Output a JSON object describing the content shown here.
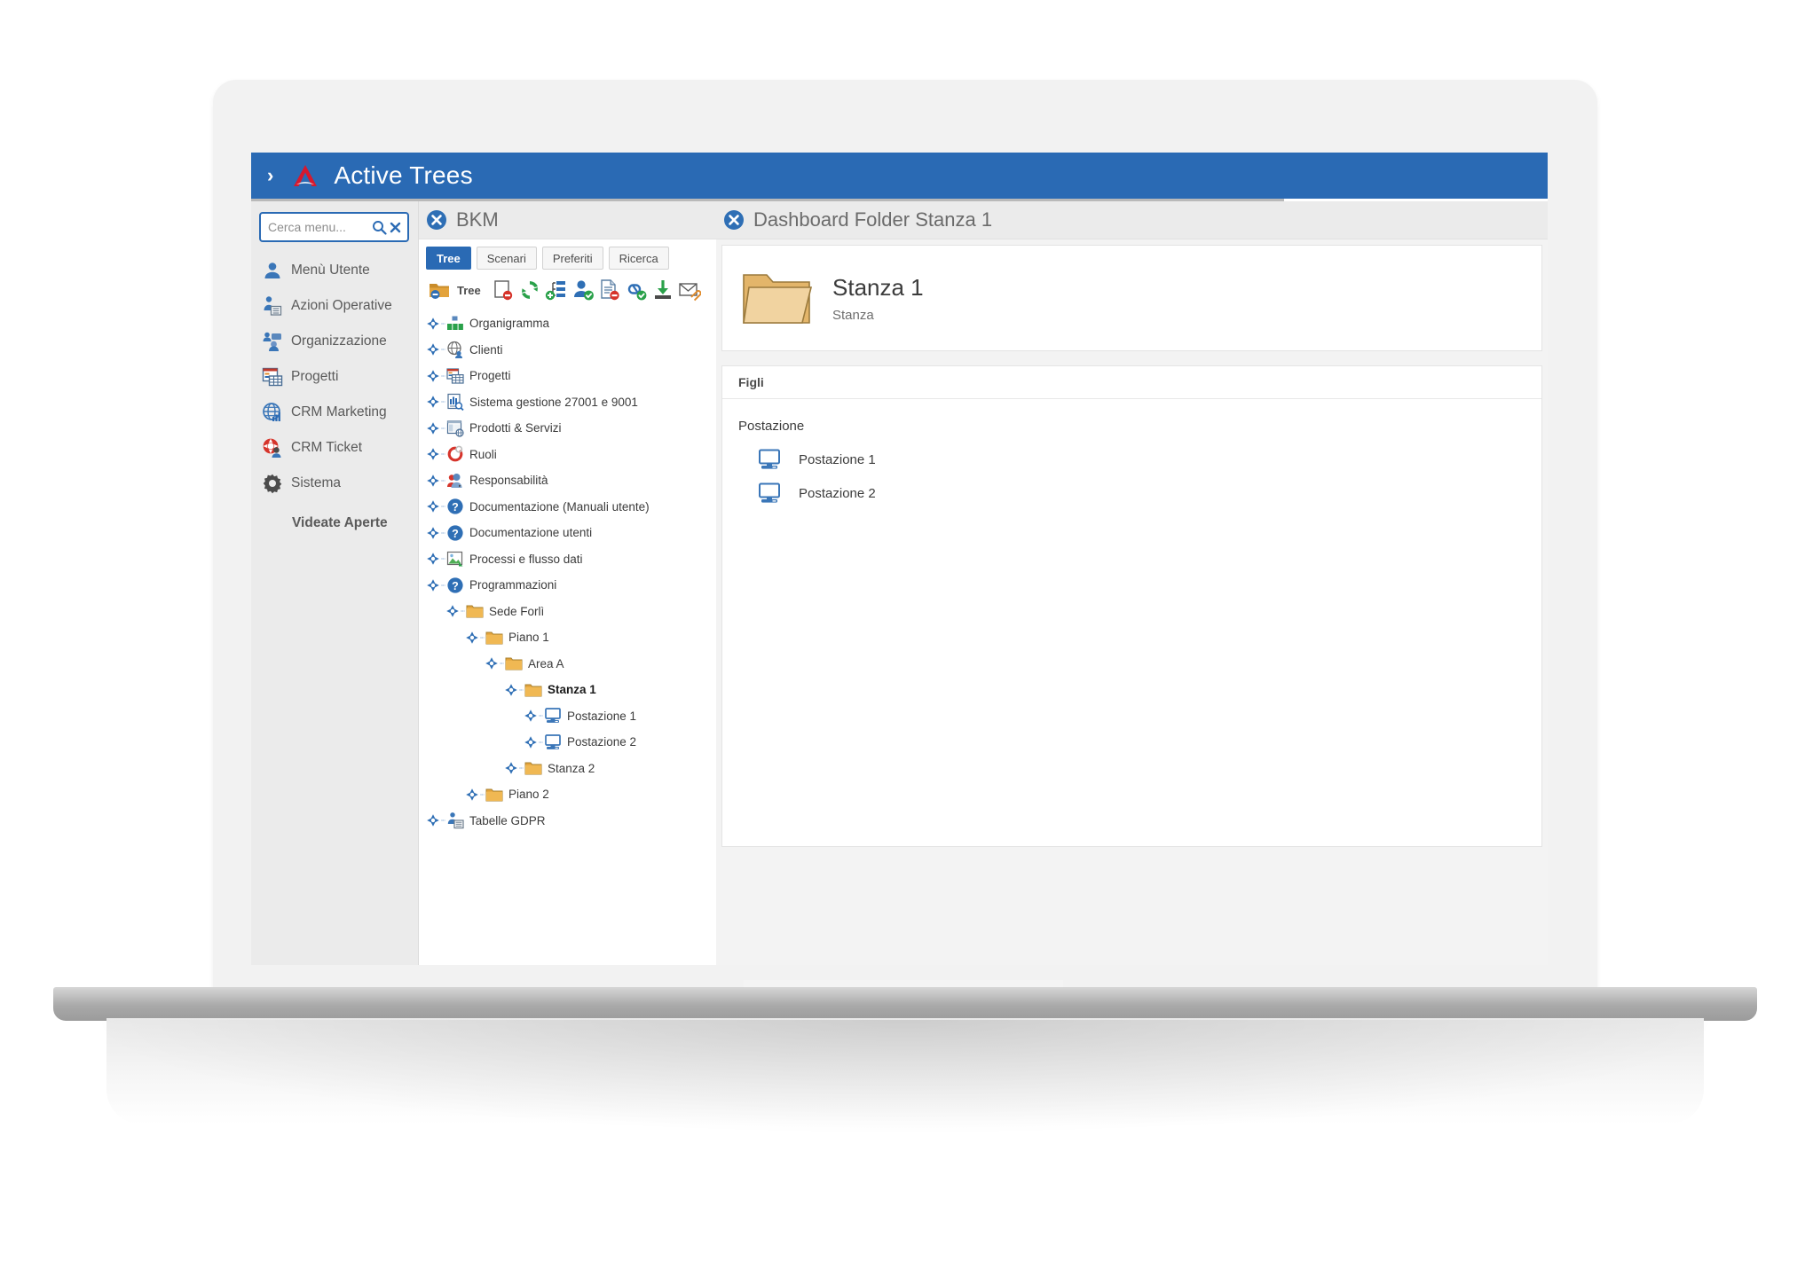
{
  "app": {
    "header": {
      "chevron": "›",
      "logo_icon": "active-trees-logo",
      "title": "Active Trees",
      "color": "#2a6ab4"
    }
  },
  "sidebar": {
    "search": {
      "placeholder": "Cerca menu...",
      "value": "",
      "search_icon": "search-icon",
      "clear_icon": "clear-icon"
    },
    "items": [
      {
        "label": "Menù Utente",
        "icon": "user-icon"
      },
      {
        "label": "Azioni Operative",
        "icon": "operative-actions-icon"
      },
      {
        "label": "Organizzazione",
        "icon": "organization-icon"
      },
      {
        "label": "Progetti",
        "icon": "projects-icon"
      },
      {
        "label": "CRM Marketing",
        "icon": "crm-marketing-icon"
      },
      {
        "label": "CRM Ticket",
        "icon": "crm-ticket-icon"
      },
      {
        "label": "Sistema",
        "icon": "gear-icon"
      }
    ],
    "footer_label": "Videate Aperte"
  },
  "bkm": {
    "close_icon": "close-icon",
    "title": "BKM",
    "tabs": [
      {
        "label": "Tree",
        "active": true
      },
      {
        "label": "Scenari",
        "active": false
      },
      {
        "label": "Preferiti",
        "active": false
      },
      {
        "label": "Ricerca",
        "active": false
      }
    ],
    "toolbar": {
      "tree_label": "Tree",
      "buttons": [
        "folder-remove-icon",
        "new-page-remove-icon",
        "refresh-icon",
        "add-node-icon",
        "assign-user-icon",
        "document-remove-icon",
        "link-confirm-icon",
        "download-icon",
        "mail-attach-icon"
      ]
    },
    "tree": [
      {
        "label": "Organigramma",
        "icon": "orgchart-icon",
        "depth": 0,
        "selected": false
      },
      {
        "label": "Clienti",
        "icon": "globe-user-icon",
        "depth": 0,
        "selected": false
      },
      {
        "label": "Progetti",
        "icon": "projects-icon",
        "depth": 0,
        "selected": false
      },
      {
        "label": "Sistema gestione 27001 e 9001",
        "icon": "report-search-icon",
        "depth": 0,
        "selected": false
      },
      {
        "label": "Prodotti & Servizi",
        "icon": "products-icon",
        "depth": 0,
        "selected": false
      },
      {
        "label": "Ruoli",
        "icon": "roles-icon",
        "depth": 0,
        "selected": false
      },
      {
        "label": "Responsabilità",
        "icon": "responsibility-icon",
        "depth": 0,
        "selected": false
      },
      {
        "label": "Documentazione (Manuali utente)",
        "icon": "help-icon",
        "depth": 0,
        "selected": false
      },
      {
        "label": "Documentazione utenti",
        "icon": "help-icon",
        "depth": 0,
        "selected": false
      },
      {
        "label": "Processi e flusso dati",
        "icon": "image-flow-icon",
        "depth": 0,
        "selected": false
      },
      {
        "label": "Programmazioni",
        "icon": "help-icon",
        "depth": 0,
        "selected": false
      },
      {
        "label": "Sede Forlì",
        "icon": "folder-icon",
        "depth": 1,
        "selected": false
      },
      {
        "label": "Piano 1",
        "icon": "folder-icon",
        "depth": 2,
        "selected": false
      },
      {
        "label": "Area A",
        "icon": "folder-icon",
        "depth": 3,
        "selected": false
      },
      {
        "label": "Stanza 1",
        "icon": "folder-icon",
        "depth": 4,
        "selected": true
      },
      {
        "label": "Postazione 1",
        "icon": "workstation-icon",
        "depth": 5,
        "selected": false
      },
      {
        "label": "Postazione 2",
        "icon": "workstation-icon",
        "depth": 5,
        "selected": false
      },
      {
        "label": "Stanza 2",
        "icon": "folder-icon",
        "depth": 4,
        "selected": false
      },
      {
        "label": "Piano 2",
        "icon": "folder-icon",
        "depth": 2,
        "selected": false
      },
      {
        "label": "Tabelle GDPR",
        "icon": "gdpr-table-icon",
        "depth": 0,
        "selected": false
      }
    ]
  },
  "dashboard": {
    "close_icon": "close-icon",
    "title": "Dashboard Folder Stanza 1",
    "card": {
      "icon": "folder-large-icon",
      "name": "Stanza 1",
      "type": "Stanza"
    },
    "children_section": {
      "header": "Figli",
      "group_label": "Postazione",
      "items": [
        {
          "label": "Postazione 1",
          "icon": "workstation-icon"
        },
        {
          "label": "Postazione 2",
          "icon": "workstation-icon"
        }
      ]
    }
  }
}
